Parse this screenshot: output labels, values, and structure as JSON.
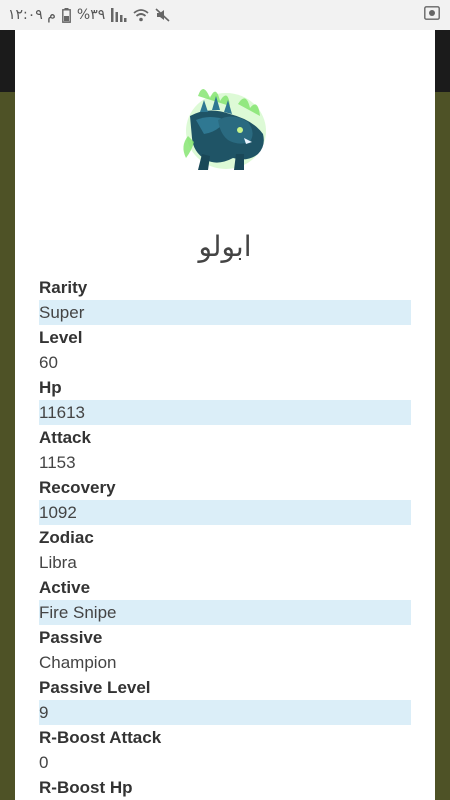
{
  "status_bar": {
    "time": "۱۲:۰۹ م",
    "battery": "%۳۹",
    "icons": [
      "battery-icon",
      "signal-icon",
      "wifi-icon",
      "mute-icon",
      "screenshot-icon"
    ]
  },
  "monster": {
    "name": "ابولو",
    "image": "dragon-monster-icon"
  },
  "stats": [
    {
      "label": "Rarity",
      "value": "Super"
    },
    {
      "label": "Level",
      "value": "60"
    },
    {
      "label": "Hp",
      "value": "11613"
    },
    {
      "label": "Attack",
      "value": "1153"
    },
    {
      "label": "Recovery",
      "value": "1092"
    },
    {
      "label": "Zodiac",
      "value": "Libra"
    },
    {
      "label": "Active",
      "value": "Fire Snipe"
    },
    {
      "label": "Passive",
      "value": "Champion"
    },
    {
      "label": "Passive Level",
      "value": "9"
    },
    {
      "label": "R-Boost Attack",
      "value": "0"
    },
    {
      "label": "R-Boost Hp",
      "value": ""
    }
  ],
  "colors": {
    "highlight_row": "#dbeef8",
    "background_olive": "#4e5226",
    "app_bar": "#1b1b1b"
  }
}
